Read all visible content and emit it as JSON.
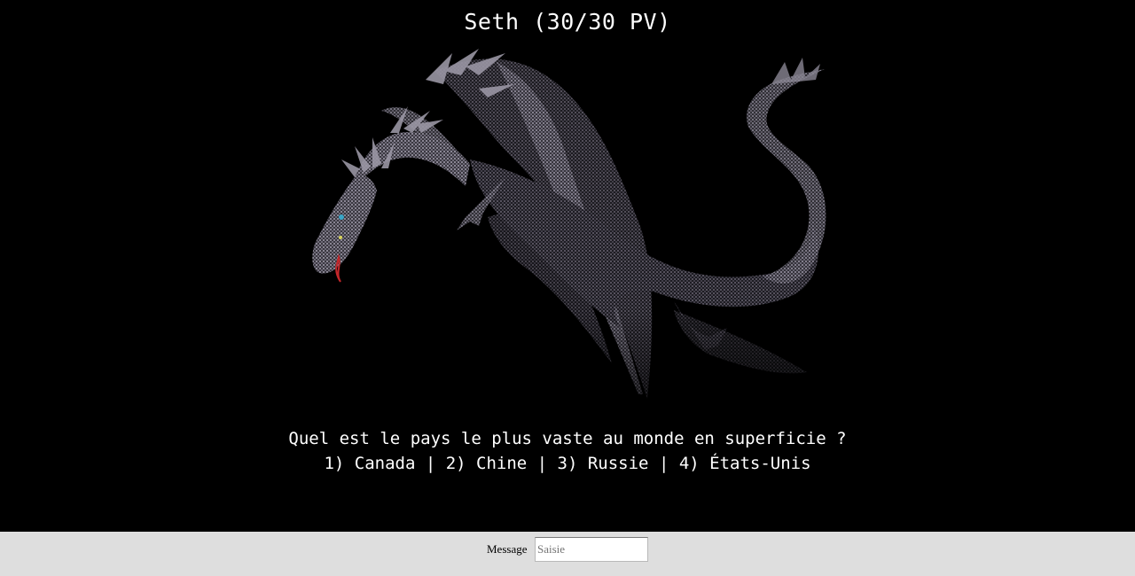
{
  "game": {
    "enemy_status": "Seth (30/30 PV)",
    "enemy_image": "dragon-illustration",
    "question": "Quel est le pays le plus vaste au monde en superficie ?",
    "answers_line": "1) Canada | 2) Chine | 3) Russie | 4) États-Unis"
  },
  "input_bar": {
    "label": "Message",
    "placeholder": "Saisie",
    "value": ""
  },
  "colors": {
    "background": "#000000",
    "text": "#ffffff",
    "footer_bg": "#dedede"
  }
}
